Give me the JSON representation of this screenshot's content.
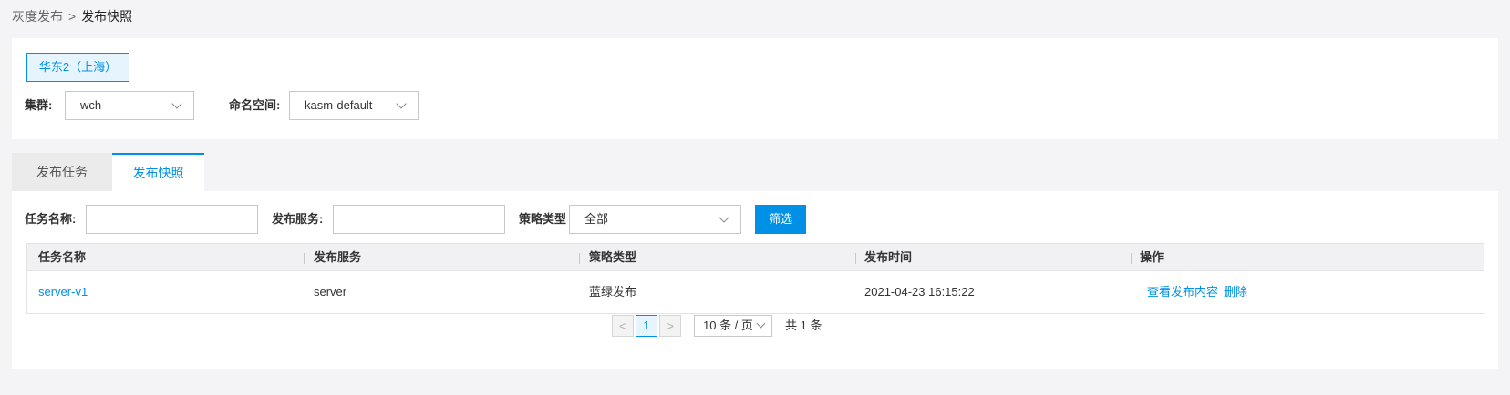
{
  "breadcrumb": {
    "parent": "灰度发布",
    "separator": ">",
    "current": "发布快照"
  },
  "region": {
    "label": "华东2（上海）"
  },
  "filters_top": {
    "cluster_label": "集群:",
    "cluster_value": "wch",
    "namespace_label": "命名空间:",
    "namespace_value": "kasm-default"
  },
  "tabs": [
    {
      "label": "发布任务",
      "active": false
    },
    {
      "label": "发布快照",
      "active": true
    }
  ],
  "search": {
    "task_name_label": "任务名称:",
    "task_name_value": "",
    "service_label": "发布服务:",
    "service_value": "",
    "strategy_label": "策略类型",
    "strategy_value": "全部",
    "filter_button": "筛选"
  },
  "table": {
    "columns": [
      "任务名称",
      "发布服务",
      "策略类型",
      "发布时间",
      "操作"
    ],
    "rows": [
      {
        "task_name": "server-v1",
        "service": "server",
        "strategy": "蓝绿发布",
        "time": "2021-04-23 16:15:22",
        "actions": [
          "查看发布内容",
          "删除"
        ]
      }
    ]
  },
  "pagination": {
    "prev": "<",
    "current_page": "1",
    "next": ">",
    "page_size": "10 条 / 页",
    "total": "共 1 条"
  },
  "colors": {
    "primary": "#0091e6",
    "background": "#f4f4f7",
    "panel": "#ffffff"
  }
}
